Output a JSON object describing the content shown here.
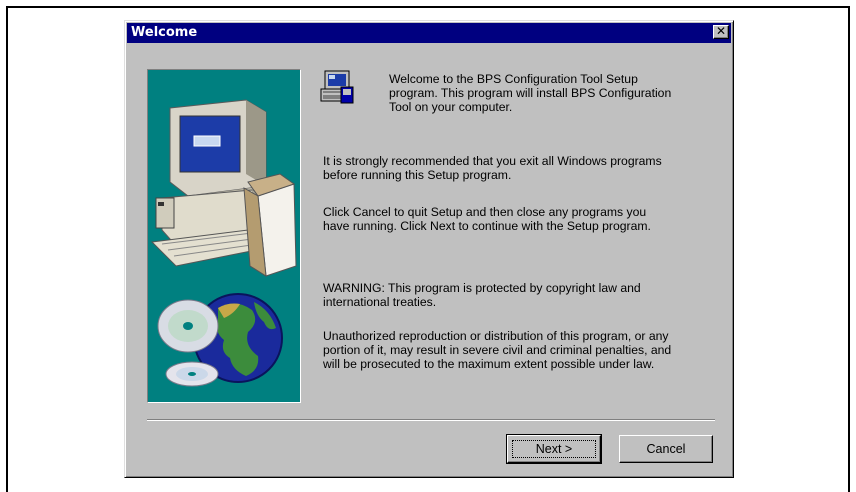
{
  "window": {
    "title": "Welcome",
    "close_glyph": "✕"
  },
  "content": {
    "intro": "Welcome to the BPS Configuration Tool Setup\nprogram.  This program will install BPS Configuration\nTool on your computer.",
    "recommend": "It is strongly recommended that you exit all Windows programs\nbefore running this Setup program.",
    "instructions": "Click Cancel to quit Setup and then close any programs you\nhave running.  Click Next to continue with the Setup program.",
    "warning": "WARNING: This program is protected by copyright law and\ninternational treaties.",
    "legal": "Unauthorized reproduction or distribution of this program, or any\nportion of it, may result in severe civil and criminal penalties, and\nwill be prosecuted to the maximum extent possible under law."
  },
  "buttons": {
    "next": "Next >",
    "cancel": "Cancel"
  },
  "icons": {
    "setup": "setup-computer-icon",
    "art": "computer-and-globe-illustration"
  },
  "colors": {
    "title_bar": "#000080",
    "dialog_bg": "#c0c0c0",
    "art_bg": "#008080"
  }
}
